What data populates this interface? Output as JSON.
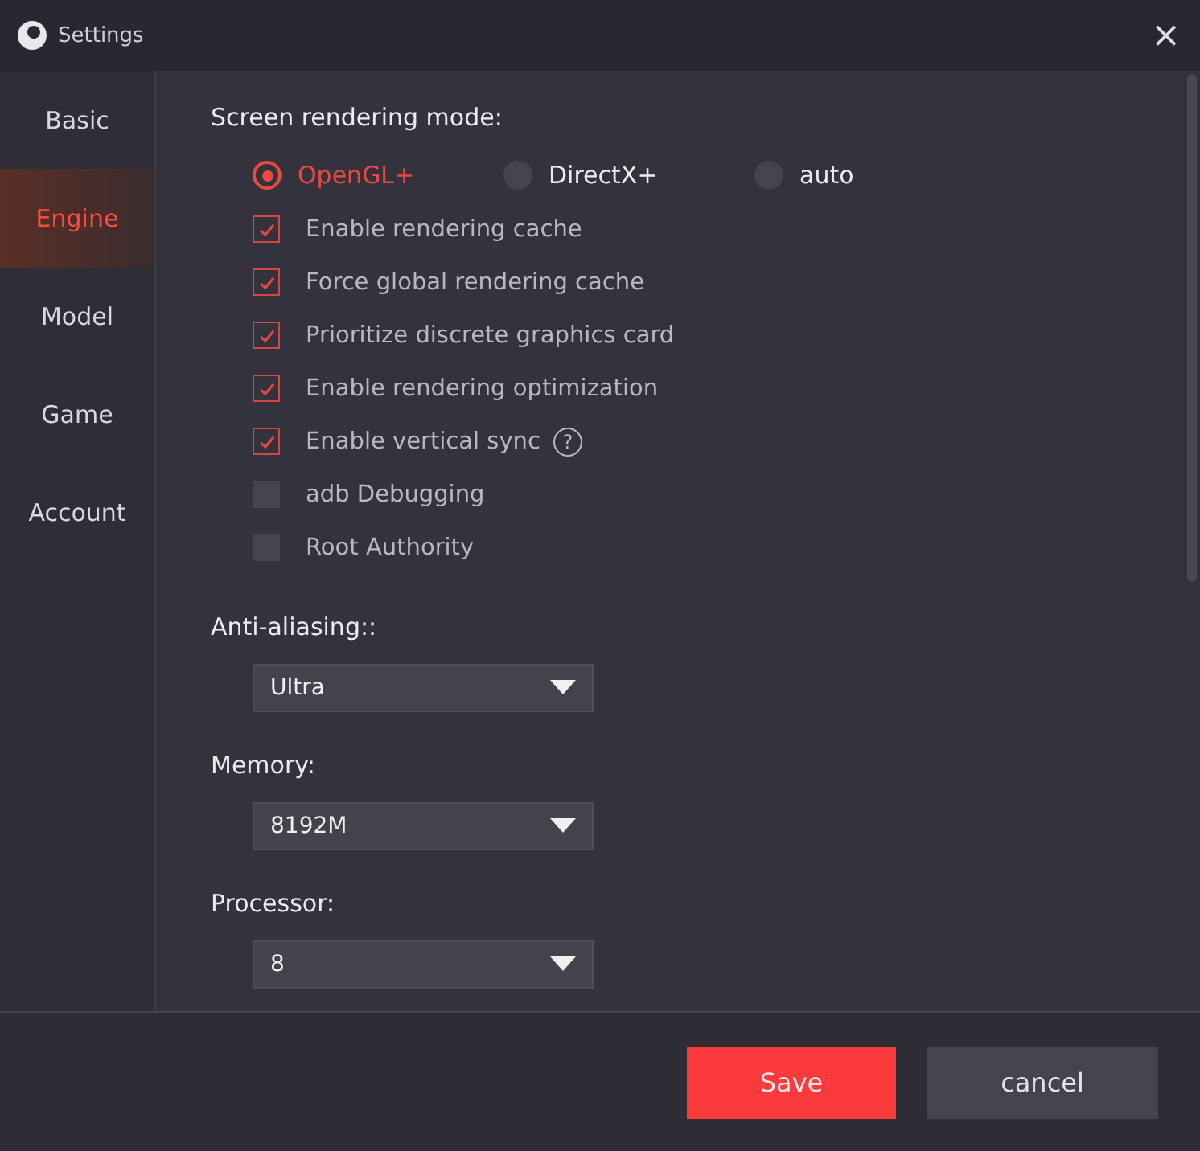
{
  "window": {
    "title": "Settings",
    "close": "×"
  },
  "sidebar": {
    "items": [
      {
        "label": "Basic",
        "selected": false
      },
      {
        "label": "Engine",
        "selected": true
      },
      {
        "label": "Model",
        "selected": false
      },
      {
        "label": "Game",
        "selected": false
      },
      {
        "label": "Account",
        "selected": false
      }
    ]
  },
  "rendering_mode": {
    "label": "Screen rendering mode:",
    "options": [
      {
        "label": "OpenGL+",
        "selected": true
      },
      {
        "label": "DirectX+",
        "selected": false
      },
      {
        "label": "auto",
        "selected": false
      }
    ]
  },
  "options": [
    {
      "label": "Enable rendering cache",
      "checked": true
    },
    {
      "label": "Force global rendering cache",
      "checked": true
    },
    {
      "label": "Prioritize discrete graphics card",
      "checked": true
    },
    {
      "label": "Enable rendering optimization",
      "checked": true
    },
    {
      "label": "Enable vertical sync",
      "checked": true,
      "help": "?"
    },
    {
      "label": "adb Debugging",
      "checked": false
    },
    {
      "label": "Root Authority",
      "checked": false
    }
  ],
  "selects": [
    {
      "label": "Anti-aliasing::",
      "value": "Ultra"
    },
    {
      "label": "Memory:",
      "value": "8192M"
    },
    {
      "label": "Processor:",
      "value": "8"
    }
  ],
  "buttons": {
    "save": "Save",
    "cancel": "cancel"
  }
}
